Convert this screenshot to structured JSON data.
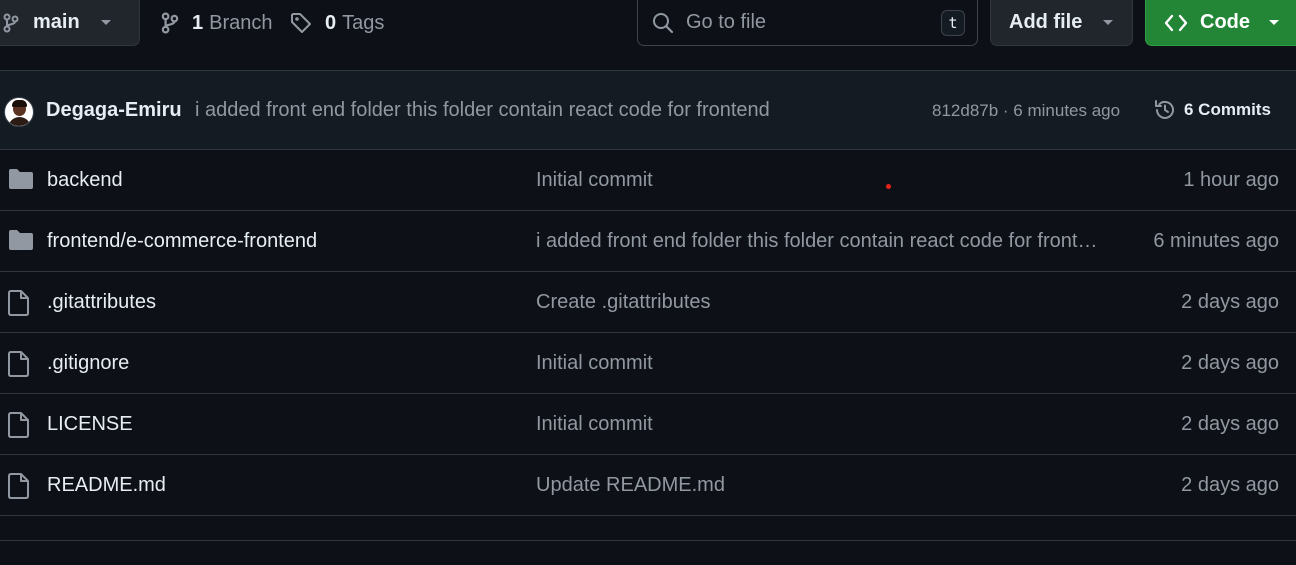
{
  "toolbar": {
    "branch": "main",
    "branch_count": "1",
    "branch_label": "Branch",
    "tag_count": "0",
    "tag_label": "Tags",
    "search_placeholder": "Go to file",
    "search_shortcut": "t",
    "add_file_label": "Add file",
    "code_label": "Code"
  },
  "latest_commit": {
    "author": "Degaga-Emiru",
    "message": "i added front end folder this folder contain react code for frontend",
    "hash_time": "812d87b · 6 minutes ago",
    "commits_label": "6 Commits"
  },
  "files": [
    {
      "type": "folder",
      "name": "backend",
      "message": "Initial commit",
      "time": "1 hour ago"
    },
    {
      "type": "folder",
      "name": "frontend/e-commerce-frontend",
      "message": "i added front end folder this folder contain react code for frontend",
      "time": "6 minutes ago"
    },
    {
      "type": "file",
      "name": ".gitattributes",
      "message": "Create .gitattributes",
      "time": "2 days ago"
    },
    {
      "type": "file",
      "name": ".gitignore",
      "message": "Initial commit",
      "time": "2 days ago"
    },
    {
      "type": "file",
      "name": "LICENSE",
      "message": "Initial commit",
      "time": "2 days ago"
    },
    {
      "type": "file",
      "name": "README.md",
      "message": "Update README.md",
      "time": "2 days ago"
    }
  ],
  "colors": {
    "background": "#0d1117",
    "header_bg": "#151b23",
    "border": "#30363d",
    "muted_text": "#9198a1",
    "primary_text": "#e6edf3",
    "code_button": "#238636",
    "folder_icon": "#9198a1"
  }
}
